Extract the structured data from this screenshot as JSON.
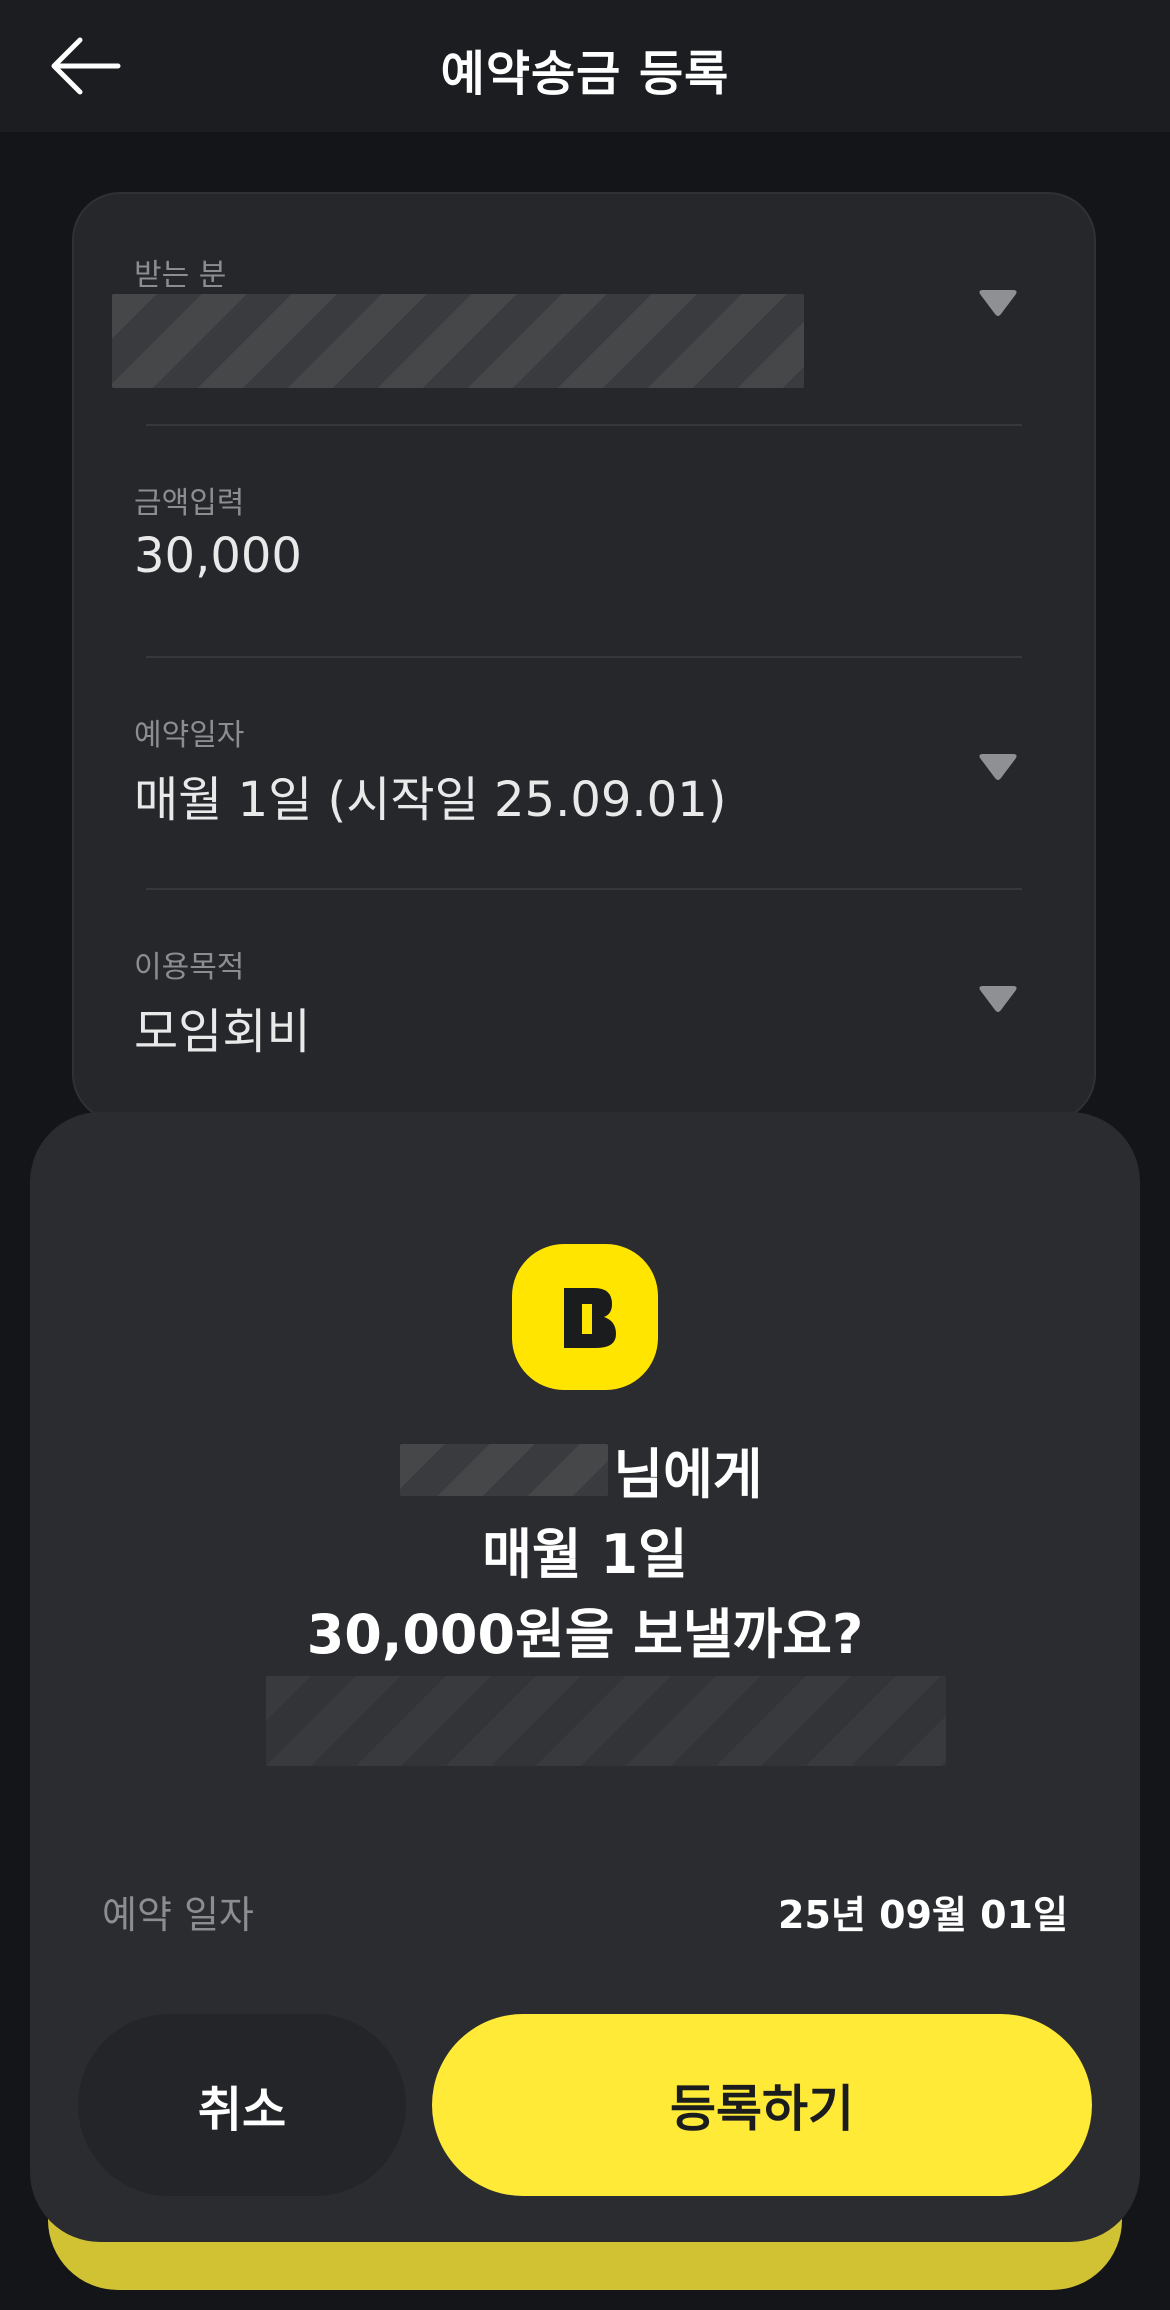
{
  "header": {
    "title": "예약송금 등록",
    "back_icon": "arrow-left-icon"
  },
  "form": {
    "recipient": {
      "label": "받는 분",
      "value": ""
    },
    "amount": {
      "label": "금액입력",
      "value": "30,000"
    },
    "date": {
      "label": "예약일자",
      "value": "매월 1일 (시작일 25.09.01)"
    },
    "purpose": {
      "label": "이용목적",
      "value": "모임회비"
    }
  },
  "confirm_sheet": {
    "logo_letter": "B",
    "recipient_suffix": "님에게",
    "schedule_line": "매월 1일",
    "amount_line": "30,000원을 보낼까요?",
    "schedule_label": "예약 일자",
    "schedule_value": "25년 09월 01일",
    "cancel_label": "취소",
    "confirm_label": "등록하기"
  },
  "colors": {
    "accent": "#feea37",
    "logo": "#ffe500",
    "background": "#131518",
    "sheet": "#2a2c2f"
  }
}
